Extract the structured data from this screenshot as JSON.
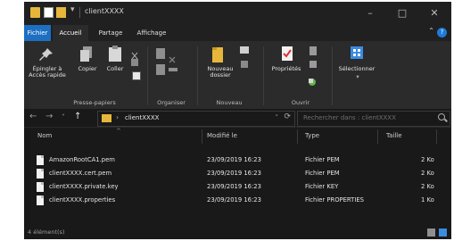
{
  "window": {
    "title": "clientXXXX",
    "controls": {
      "minimize": "–",
      "maximize": "□",
      "close": "✕"
    }
  },
  "ribbon_tabs": [
    "Fichier",
    "Accueil",
    "Partage",
    "Affichage"
  ],
  "ribbon": {
    "pin_label_1": "Épingler à",
    "pin_label_2": "Accès rapide",
    "copy_label": "Copier",
    "paste_label": "Coller",
    "new_folder_label_1": "Nouveau",
    "new_folder_label_2": "dossier",
    "properties_label": "Propriétés",
    "select_label": "Sélectionner",
    "groups": {
      "clipboard": "Presse-papiers",
      "organize": "Organiser",
      "new": "Nouveau",
      "open": "Ouvrir"
    }
  },
  "address": {
    "path": "clientXXXX",
    "search_placeholder": "Rechercher dans : clientXXXX"
  },
  "columns": [
    "Nom",
    "Modifié le",
    "Type",
    "Taille"
  ],
  "files": [
    {
      "name": "AmazonRootCA1.pem",
      "modified": "23/09/2019 16:23",
      "type": "Fichier PEM",
      "size": "2 Ko"
    },
    {
      "name": "clientXXXX.cert.pem",
      "modified": "23/09/2019 16:23",
      "type": "Fichier PEM",
      "size": "2 Ko"
    },
    {
      "name": "clientXXXX.private.key",
      "modified": "23/09/2019 16:23",
      "type": "Fichier KEY",
      "size": "2 Ko"
    },
    {
      "name": "clientXXXX.properties",
      "modified": "23/09/2019 16:23",
      "type": "Fichier PROPERTIES",
      "size": "1 Ko"
    }
  ],
  "status": {
    "text": "4 élément(s)"
  },
  "colors": {
    "accent": "#1c6fc2",
    "folder": "#e6b73a",
    "background": "#191919"
  }
}
